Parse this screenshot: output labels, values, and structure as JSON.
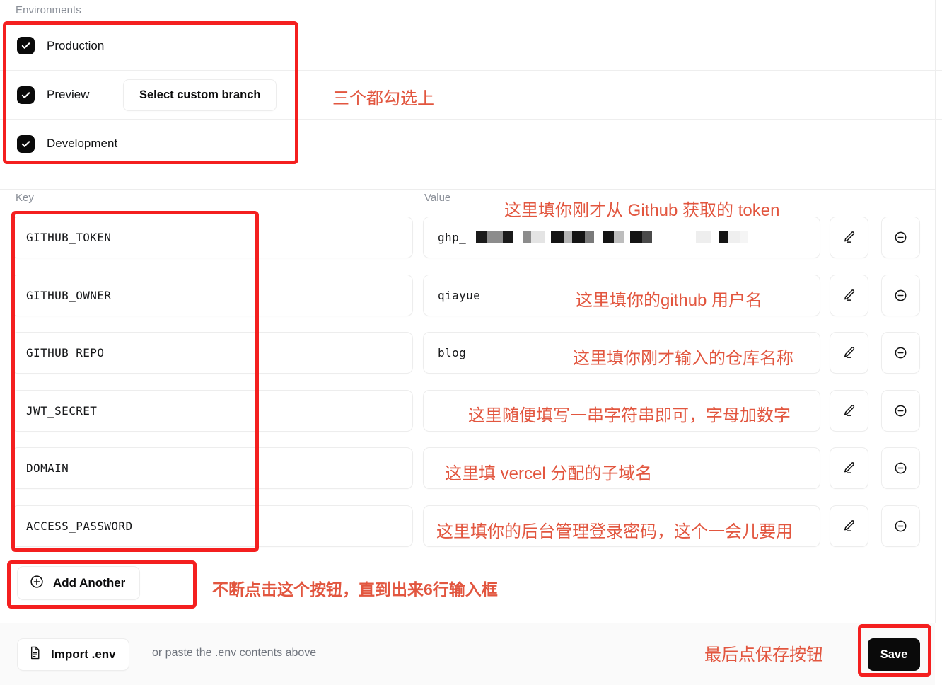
{
  "environments": {
    "section_label": "Environments",
    "items": [
      {
        "name": "Production",
        "checked": true
      },
      {
        "name": "Preview",
        "checked": true,
        "branch_button": "Select custom branch"
      },
      {
        "name": "Development",
        "checked": true
      }
    ]
  },
  "columns": {
    "key": "Key",
    "value": "Value"
  },
  "rows": [
    {
      "key": "GITHUB_TOKEN",
      "value": "ghp_",
      "value_censored": true,
      "edit": "edit-icon",
      "remove": "remove-icon"
    },
    {
      "key": "GITHUB_OWNER",
      "value": "qiayue",
      "value_censored": false,
      "edit": "edit-icon",
      "remove": "remove-icon"
    },
    {
      "key": "GITHUB_REPO",
      "value": "blog",
      "value_censored": false,
      "edit": "edit-icon",
      "remove": "remove-icon"
    },
    {
      "key": "JWT_SECRET",
      "value": "",
      "value_censored": false,
      "edit": "edit-icon",
      "remove": "remove-icon"
    },
    {
      "key": "DOMAIN",
      "value": "",
      "value_censored": false,
      "edit": "edit-icon",
      "remove": "remove-icon"
    },
    {
      "key": "ACCESS_PASSWORD",
      "value": "",
      "value_censored": false,
      "edit": "edit-icon",
      "remove": "remove-icon"
    }
  ],
  "add_another": {
    "label": "Add Another",
    "icon": "plus-circle-icon"
  },
  "footer": {
    "import_label": "Import .env",
    "import_icon": "file-icon",
    "paste_hint": "or paste the .env contents above",
    "save_label": "Save"
  },
  "annotations": {
    "environments_note": "三个都勾选上",
    "token_note": "这里填你刚才从 Github 获取的 token",
    "owner_note": "这里填你的github 用户名",
    "repo_note": "这里填你刚才输入的仓库名称",
    "jwt_note": "这里随便填写一串字符串即可，字母加数字",
    "domain_note": "这里填 vercel 分配的子域名",
    "password_note": "这里填你的后台管理登录密码，这个一会儿要用",
    "add_another_note": "不断点击这个按钮，直到出来6行输入框",
    "save_note": "最后点保存按钮",
    "color": "#e2563f",
    "box_color": "#f41f1f"
  }
}
